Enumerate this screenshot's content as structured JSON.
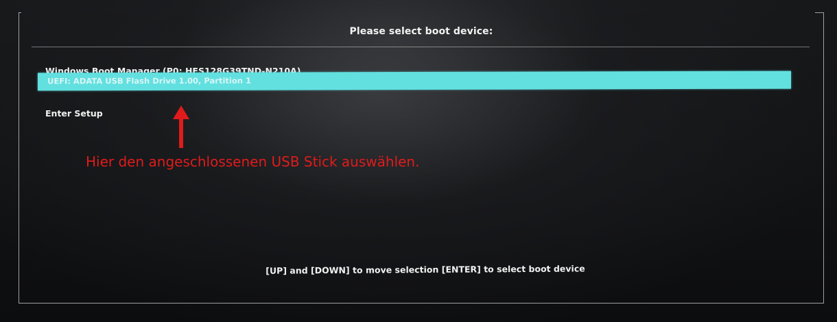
{
  "screen": {
    "title": "Please select boot device:",
    "footer_hint": "[UP] and [DOWN] to move selection  [ENTER] to select boot device"
  },
  "boot_menu": {
    "items": [
      {
        "label": "Windows Boot Manager (P0: HFS128G39TND-N210A)",
        "selected": false
      },
      {
        "label": "UEFI: ADATA USB Flash Drive 1.00, Partition 1",
        "selected": true
      },
      {
        "label": "Enter Setup",
        "selected": false
      }
    ],
    "highlight_color": "#62e0e0"
  },
  "annotation": {
    "text": "Hier den angeschlossenen USB Stick auswählen.",
    "color": "#e01b1b",
    "arrow_icon": "arrow-up-icon"
  }
}
